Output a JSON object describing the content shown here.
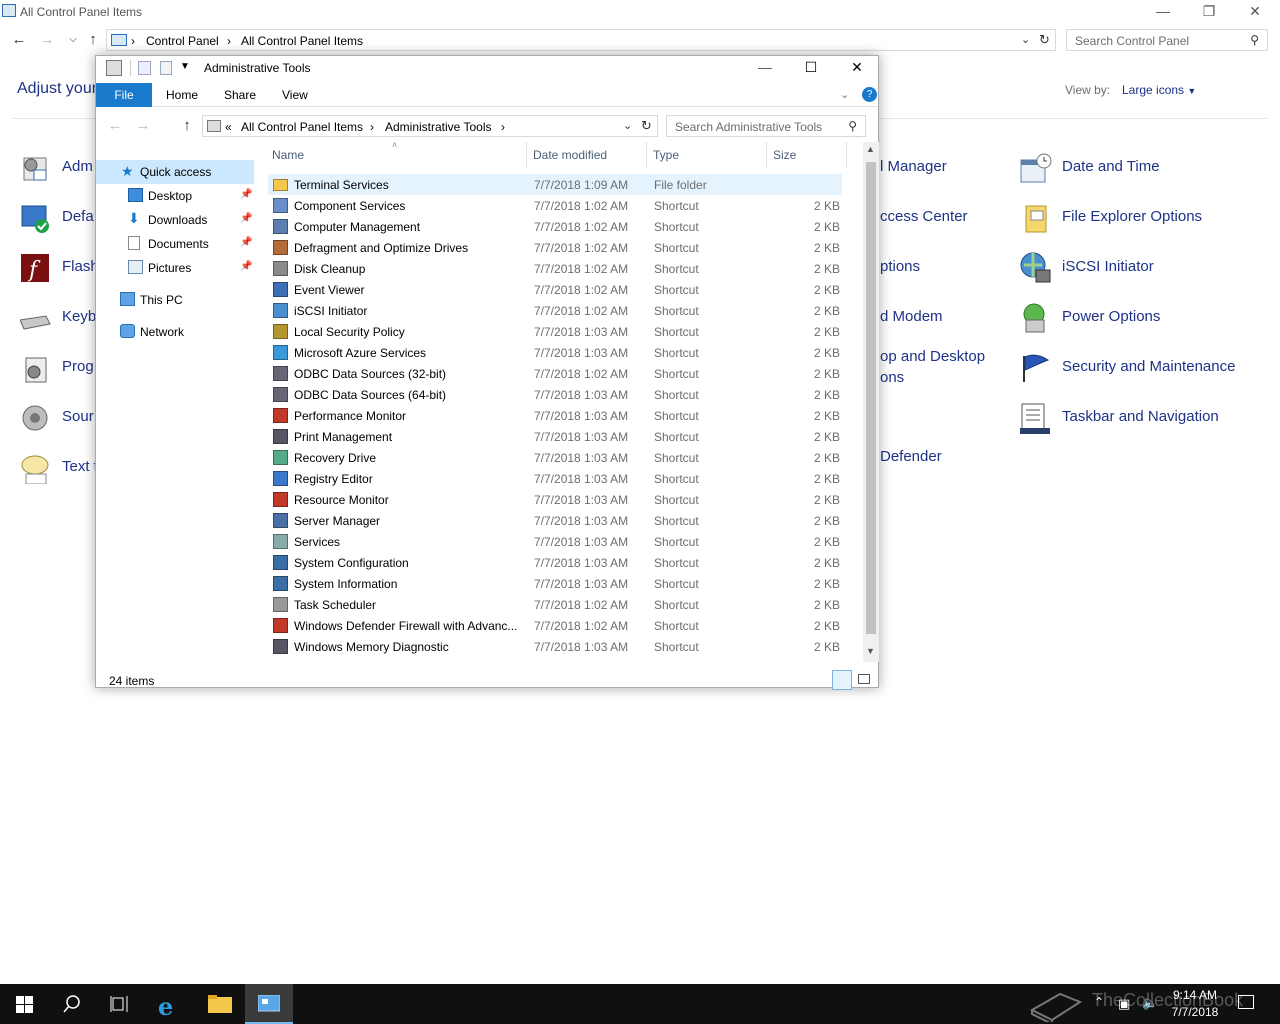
{
  "control_panel": {
    "title": "All Control Panel Items",
    "breadcrumb": [
      "Control Panel",
      "All Control Panel Items"
    ],
    "search_placeholder": "Search Control Panel",
    "heading": "Adjust your",
    "view_by_label": "View by:",
    "view_by_value": "Large icons",
    "left_items": [
      "Adm",
      "Defa",
      "Flash",
      "Keyb",
      "Prog",
      "Sour",
      "Text t"
    ],
    "middle_items": [
      "l Manager",
      "ccess Center",
      "ptions",
      "d Modem",
      "op and Desktop",
      "ons",
      "Defender"
    ],
    "right_items": [
      "Date and Time",
      "File Explorer Options",
      "iSCSI Initiator",
      "Power Options",
      "Security and Maintenance",
      "Taskbar and Navigation"
    ]
  },
  "explorer": {
    "title": "Administrative Tools",
    "tabs": [
      "File",
      "Home",
      "Share",
      "View"
    ],
    "breadcrumb": [
      "«",
      "All Control Panel Items",
      "Administrative Tools"
    ],
    "search_placeholder": "Search Administrative Tools",
    "sidebar": [
      {
        "label": "Quick access",
        "icon": "star-icon"
      },
      {
        "label": "Desktop",
        "icon": "desktop-icon"
      },
      {
        "label": "Downloads",
        "icon": "download-icon"
      },
      {
        "label": "Documents",
        "icon": "document-icon"
      },
      {
        "label": "Pictures",
        "icon": "picture-icon"
      },
      {
        "label": "This PC",
        "icon": "computer-icon"
      },
      {
        "label": "Network",
        "icon": "network-icon"
      }
    ],
    "columns": [
      "Name",
      "Date modified",
      "Type",
      "Size"
    ],
    "files": [
      {
        "name": "Terminal Services",
        "date": "7/7/2018 1:09 AM",
        "type": "File folder",
        "size": ""
      },
      {
        "name": "Component Services",
        "date": "7/7/2018 1:02 AM",
        "type": "Shortcut",
        "size": "2 KB"
      },
      {
        "name": "Computer Management",
        "date": "7/7/2018 1:02 AM",
        "type": "Shortcut",
        "size": "2 KB"
      },
      {
        "name": "Defragment and Optimize Drives",
        "date": "7/7/2018 1:02 AM",
        "type": "Shortcut",
        "size": "2 KB"
      },
      {
        "name": "Disk Cleanup",
        "date": "7/7/2018 1:02 AM",
        "type": "Shortcut",
        "size": "2 KB"
      },
      {
        "name": "Event Viewer",
        "date": "7/7/2018 1:02 AM",
        "type": "Shortcut",
        "size": "2 KB"
      },
      {
        "name": "iSCSI Initiator",
        "date": "7/7/2018 1:02 AM",
        "type": "Shortcut",
        "size": "2 KB"
      },
      {
        "name": "Local Security Policy",
        "date": "7/7/2018 1:03 AM",
        "type": "Shortcut",
        "size": "2 KB"
      },
      {
        "name": "Microsoft Azure Services",
        "date": "7/7/2018 1:03 AM",
        "type": "Shortcut",
        "size": "2 KB"
      },
      {
        "name": "ODBC Data Sources (32-bit)",
        "date": "7/7/2018 1:02 AM",
        "type": "Shortcut",
        "size": "2 KB"
      },
      {
        "name": "ODBC Data Sources (64-bit)",
        "date": "7/7/2018 1:03 AM",
        "type": "Shortcut",
        "size": "2 KB"
      },
      {
        "name": "Performance Monitor",
        "date": "7/7/2018 1:03 AM",
        "type": "Shortcut",
        "size": "2 KB"
      },
      {
        "name": "Print Management",
        "date": "7/7/2018 1:03 AM",
        "type": "Shortcut",
        "size": "2 KB"
      },
      {
        "name": "Recovery Drive",
        "date": "7/7/2018 1:03 AM",
        "type": "Shortcut",
        "size": "2 KB"
      },
      {
        "name": "Registry Editor",
        "date": "7/7/2018 1:03 AM",
        "type": "Shortcut",
        "size": "2 KB"
      },
      {
        "name": "Resource Monitor",
        "date": "7/7/2018 1:03 AM",
        "type": "Shortcut",
        "size": "2 KB"
      },
      {
        "name": "Server Manager",
        "date": "7/7/2018 1:03 AM",
        "type": "Shortcut",
        "size": "2 KB"
      },
      {
        "name": "Services",
        "date": "7/7/2018 1:03 AM",
        "type": "Shortcut",
        "size": "2 KB"
      },
      {
        "name": "System Configuration",
        "date": "7/7/2018 1:03 AM",
        "type": "Shortcut",
        "size": "2 KB"
      },
      {
        "name": "System Information",
        "date": "7/7/2018 1:03 AM",
        "type": "Shortcut",
        "size": "2 KB"
      },
      {
        "name": "Task Scheduler",
        "date": "7/7/2018 1:02 AM",
        "type": "Shortcut",
        "size": "2 KB"
      },
      {
        "name": "Windows Defender Firewall with Advanc...",
        "date": "7/7/2018 1:02 AM",
        "type": "Shortcut",
        "size": "2 KB"
      },
      {
        "name": "Windows Memory Diagnostic",
        "date": "7/7/2018 1:03 AM",
        "type": "Shortcut",
        "size": "2 KB"
      }
    ],
    "status": "24 items"
  },
  "taskbar": {
    "time": "9:14 AM",
    "date": "7/7/2018",
    "watermark": "TheCollectionBook"
  },
  "colors": {
    "link": "#1e3287",
    "accent": "#1979ca",
    "selection": "#e5f3ff"
  }
}
